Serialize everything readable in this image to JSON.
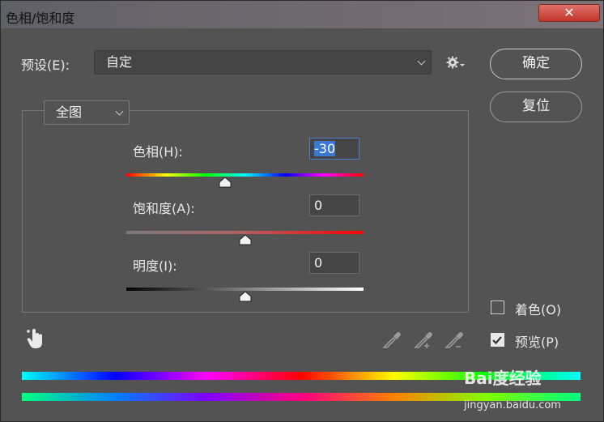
{
  "window": {
    "title": "色相/饱和度",
    "close_label": "✕"
  },
  "preset": {
    "label": "预设(E):",
    "value": "自定",
    "settings_icon": "gear-icon"
  },
  "buttons": {
    "ok": "确定",
    "reset": "复位"
  },
  "channel": {
    "value": "全图"
  },
  "sliders": {
    "hue": {
      "label": "色相(H):",
      "value": "-30",
      "level": 0.4167
    },
    "saturation": {
      "label": "饱和度(A):",
      "value": "0",
      "level": 0.5
    },
    "lightness": {
      "label": "明度(I):",
      "value": "0",
      "level": 0.5
    }
  },
  "options": {
    "colorize": {
      "label": "着色(O)",
      "checked": false
    },
    "preview": {
      "label": "预览(P)",
      "checked": true
    }
  },
  "tools": {
    "targeted_adjust": "hand-pointer-icon",
    "eyedropper": "eyedropper-icon",
    "eyedropper_add": "eyedropper-add-icon",
    "eyedropper_subtract": "eyedropper-subtract-icon"
  },
  "watermark": {
    "line1": "Bai度经验",
    "line2": "jingyan.baidu.com"
  },
  "colors": {
    "dialog_bg": "#535353",
    "field_bg": "#454545",
    "focus": "#3a78d4"
  }
}
